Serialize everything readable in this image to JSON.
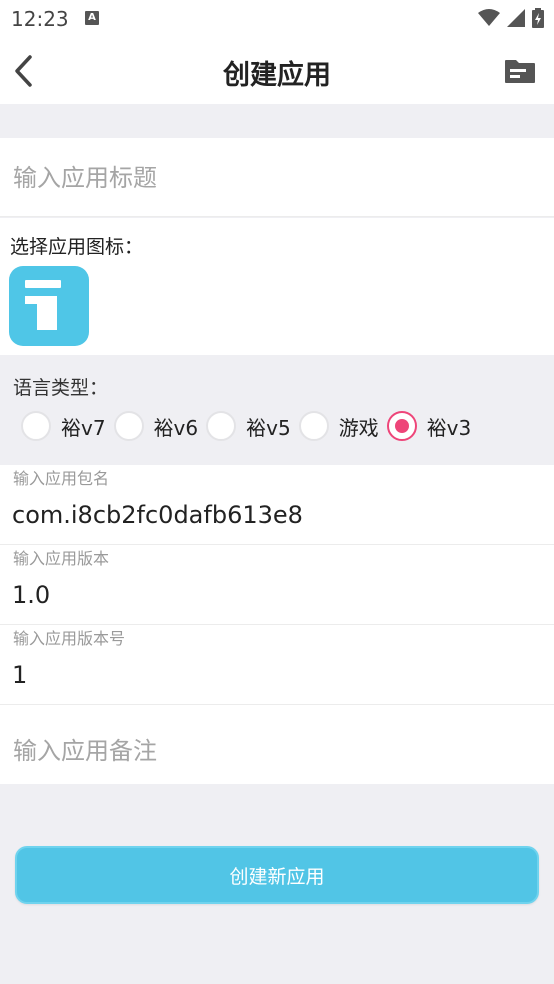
{
  "status_bar": {
    "time": "12:23",
    "a_icon": "A"
  },
  "app_bar": {
    "title": "创建应用",
    "back_icon": "chevron-left-icon",
    "action_icon": "folder-icon"
  },
  "title_field": {
    "placeholder": "输入应用标题",
    "value": ""
  },
  "icon_section": {
    "label": "选择应用图标：",
    "icon_color": "#4fc6e7"
  },
  "language": {
    "label": "语言类型：",
    "options": [
      {
        "label": "裕v7",
        "checked": false
      },
      {
        "label": "裕v6",
        "checked": false
      },
      {
        "label": "裕v5",
        "checked": false
      },
      {
        "label": "游戏",
        "checked": false
      },
      {
        "label": "裕v3",
        "checked": true
      }
    ],
    "accent": "#ee4579"
  },
  "package_field": {
    "hint": "输入应用包名",
    "value": "com.i8cb2fc0dafb613e8"
  },
  "version_field": {
    "hint": "输入应用版本",
    "value": "1.0"
  },
  "version_code_field": {
    "hint": "输入应用版本号",
    "value": "1"
  },
  "remark_field": {
    "placeholder": "输入应用备注",
    "value": ""
  },
  "create_button": {
    "label": "创建新应用",
    "color": "#51c5e6"
  }
}
